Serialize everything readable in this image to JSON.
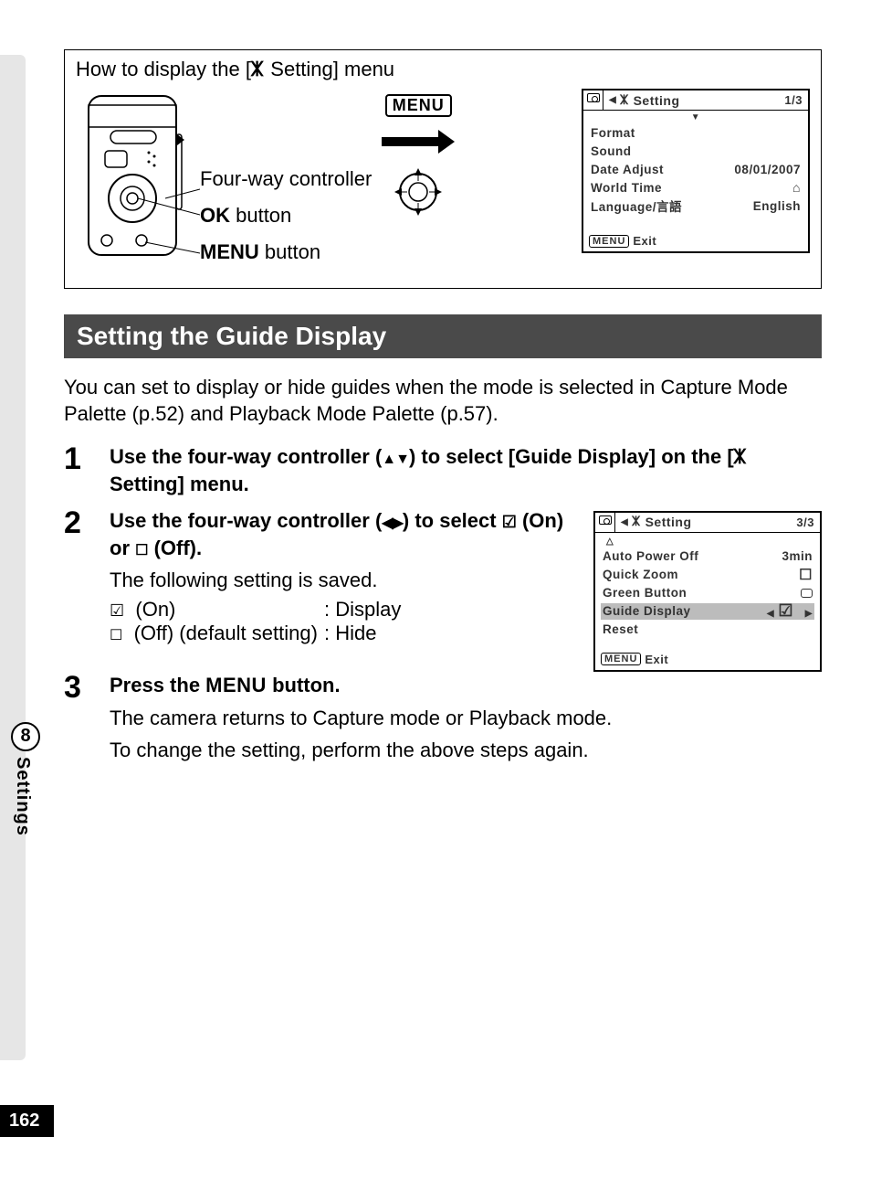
{
  "sidebar": {
    "chapter": "8",
    "label": "Settings"
  },
  "pageNumber": "162",
  "howto": {
    "title_pre": "How to display the [",
    "title_post": " Setting] menu",
    "callout1": "Four-way controller",
    "callout2_pre": "OK",
    "callout2_post": " button",
    "callout3_pre": "MENU",
    "callout3_post": " button",
    "menuLabel": "MENU"
  },
  "lcd1": {
    "tabLabel": "Setting",
    "page": "1/3",
    "rows": {
      "r1": "Format",
      "r2": "Sound",
      "r3": "Date Adjust",
      "r3v": "08/01/2007",
      "r4": "World Time",
      "r5": "Language/言語",
      "r5v": "English"
    },
    "footer": "Exit",
    "menuLabel": "MENU"
  },
  "section": "Setting the Guide Display",
  "intro": "You can set to display or hide guides when the mode is selected in Capture Mode Palette (p.52) and Playback Mode Palette (p.57).",
  "steps": {
    "s1": {
      "num": "1",
      "t_a": "Use the four-way controller (",
      "t_b": ") to select [Guide Display] on the [",
      "t_c": " Setting] menu."
    },
    "s2": {
      "num": "2",
      "t_a": "Use the four-way controller (",
      "t_b": ") to select ",
      "t_c": " (On) or ",
      "t_d": " (Off).",
      "sub": "The following setting is saved.",
      "tbl": {
        "onK_a": "(On)",
        "onV": "Display",
        "offK_a": "(Off) (default setting)",
        "offV": "Hide"
      }
    },
    "s3": {
      "num": "3",
      "t_a": "Press the ",
      "t_menu": "MENU",
      "t_b": " button.",
      "sub1": "The camera returns to Capture mode or Playback mode.",
      "sub2": "To change the setting, perform the above steps again."
    }
  },
  "lcd2": {
    "tabLabel": "Setting",
    "page": "3/3",
    "rows": {
      "r1": "Auto Power Off",
      "r1v": "3min",
      "r2": "Quick Zoom",
      "r3": "Green Button",
      "r4": "Guide Display",
      "r5": "Reset"
    },
    "footer": "Exit",
    "menuLabel": "MENU"
  }
}
